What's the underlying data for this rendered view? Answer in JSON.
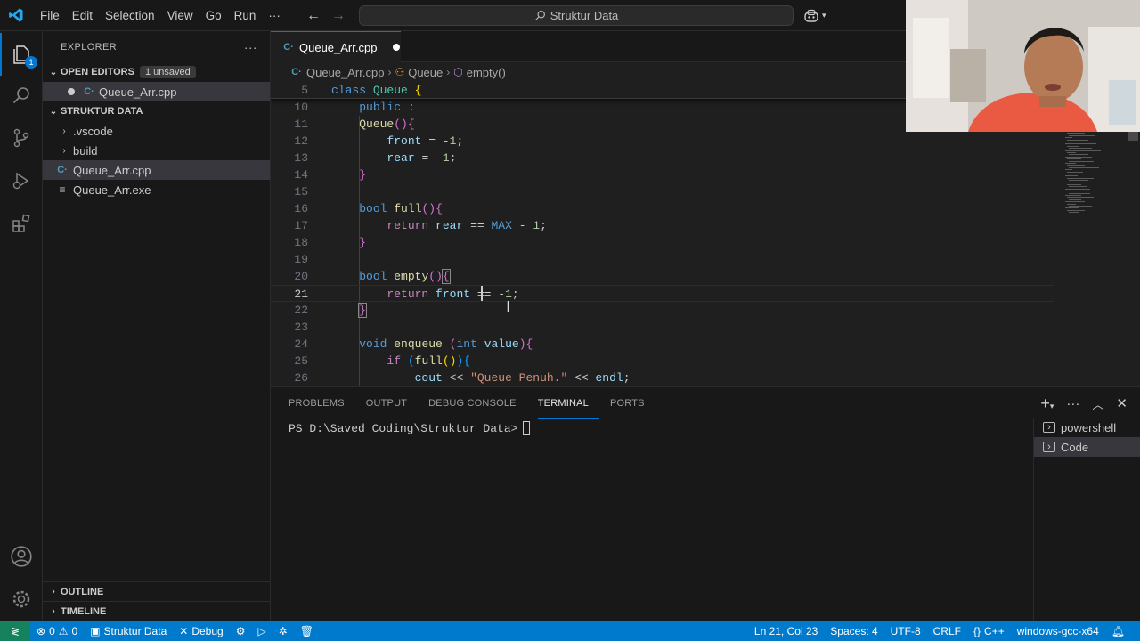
{
  "titlebar": {
    "menu": [
      "File",
      "Edit",
      "Selection",
      "View",
      "Go",
      "Run",
      "···"
    ],
    "search_label": "Struktur Data"
  },
  "activity": {
    "explorer_badge": "1"
  },
  "sidebar": {
    "title": "EXPLORER",
    "more": "···",
    "open_editors": {
      "label": "OPEN EDITORS",
      "badge": "1 unsaved",
      "file": "Queue_Arr.cpp"
    },
    "folder": {
      "label": "STRUKTUR DATA",
      "items": [
        {
          "name": ".vscode",
          "type": "folder"
        },
        {
          "name": "build",
          "type": "folder"
        },
        {
          "name": "Queue_Arr.cpp",
          "type": "cpp"
        },
        {
          "name": "Queue_Arr.exe",
          "type": "exe"
        }
      ]
    },
    "outline": "OUTLINE",
    "timeline": "TIMELINE"
  },
  "editor": {
    "tab": {
      "label": "Queue_Arr.cpp",
      "dirty": true
    },
    "breadcrumb": [
      "Queue_Arr.cpp",
      "Queue",
      "empty()"
    ],
    "lines": [
      {
        "n": "5",
        "sticky": true,
        "html": "<span class=\"kw\">class</span> <span class=\"ty\">Queue</span> <span class=\"br1\">{</span>"
      },
      {
        "n": "10",
        "html": "    <span class=\"kw\">public</span> :"
      },
      {
        "n": "11",
        "html": "    <span class=\"fn\">Queue</span><span class=\"br2\">()</span><span class=\"br2\">{</span>"
      },
      {
        "n": "12",
        "html": "        <span class=\"var\">front</span> = -<span class=\"num\">1</span>;"
      },
      {
        "n": "13",
        "html": "        <span class=\"var\">rear</span> = -<span class=\"num\">1</span>;"
      },
      {
        "n": "14",
        "html": "    <span class=\"br2\">}</span>"
      },
      {
        "n": "15",
        "html": ""
      },
      {
        "n": "16",
        "html": "    <span class=\"kw\">bool</span> <span class=\"fn\">full</span><span class=\"br2\">()</span><span class=\"br2\">{</span>"
      },
      {
        "n": "17",
        "html": "        <span class=\"ctl\">return</span> <span class=\"var\">rear</span> == <span class=\"kw\">MAX</span> - <span class=\"num\">1</span>;"
      },
      {
        "n": "18",
        "html": "    <span class=\"br2\">}</span>"
      },
      {
        "n": "19",
        "html": ""
      },
      {
        "n": "20",
        "html": "    <span class=\"kw\">bool</span> <span class=\"fn\">empty</span><span class=\"br2\">()</span><span class=\"br2\" style=\"outline:1px solid #888\">{</span>"
      },
      {
        "n": "21",
        "current": true,
        "html": "        <span class=\"ctl\">return</span> <span class=\"var\">front</span> == -<span class=\"num\">1</span>;"
      },
      {
        "n": "22",
        "html": "    <span class=\"br2\" style=\"outline:1px solid #888\">}</span>"
      },
      {
        "n": "23",
        "html": ""
      },
      {
        "n": "24",
        "html": "    <span class=\"kw\">void</span> <span class=\"fn\">enqueue</span> <span class=\"br2\">(</span><span class=\"kw\">int</span> <span class=\"var\">value</span><span class=\"br2\">)</span><span class=\"br2\">{</span>"
      },
      {
        "n": "25",
        "html": "        <span class=\"ctl\">if</span> <span class=\"br3\">(</span><span class=\"fn\">full</span><span class=\"br1\">()</span><span class=\"br3\">)</span><span class=\"br3\">{</span>"
      },
      {
        "n": "26",
        "html": "            <span class=\"var\">cout</span> &lt;&lt; <span class=\"str\">\"Queue Penuh.\"</span> &lt;&lt; <span class=\"var\">endl</span>;"
      }
    ]
  },
  "panel": {
    "tabs": [
      "PROBLEMS",
      "OUTPUT",
      "DEBUG CONSOLE",
      "TERMINAL",
      "PORTS"
    ],
    "active_tab": "TERMINAL",
    "prompt": "PS D:\\Saved Coding\\Struktur Data>",
    "terminals": [
      "powershell",
      "Code"
    ]
  },
  "statusbar": {
    "errors": "0",
    "warnings": "0",
    "project": "Struktur Data",
    "debug": "Debug",
    "position": "Ln 21, Col 23",
    "spaces": "Spaces: 4",
    "encoding": "UTF-8",
    "eol": "CRLF",
    "language": "C++",
    "compiler": "windows-gcc-x64"
  },
  "colors": {
    "accent": "#0078d4",
    "statusbar": "#007acc",
    "remote": "#16825d"
  }
}
